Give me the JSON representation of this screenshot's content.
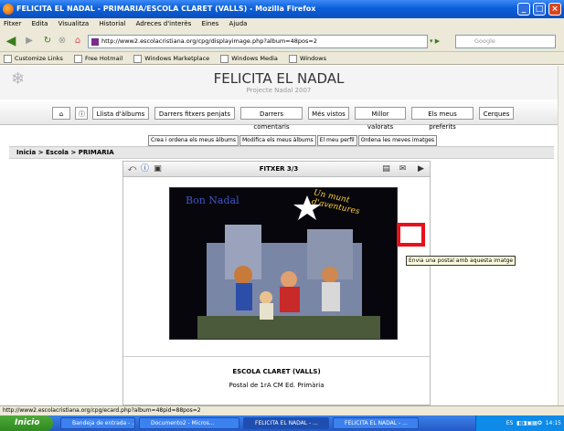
{
  "window": {
    "title": "FELICITA EL NADAL - PRIMARIA/ESCOLA CLARET (VALLS) - Mozilla Firefox"
  },
  "menubar": [
    "Fitxer",
    "Edita",
    "Visualitza",
    "Historial",
    "Adreces d'interès",
    "Eines",
    "Ajuda"
  ],
  "nav": {
    "url": "http://www2.escolacristiana.org/cpg/displayimage.php?album=48pos=2",
    "search_placeholder": "Google"
  },
  "bookmarks": [
    "Customize Links",
    "Free Hotmail",
    "Windows Marketplace",
    "Windows Media",
    "Windows"
  ],
  "site": {
    "title": "FELICITA EL NADAL",
    "subtitle": "Projecte Nadal 2007"
  },
  "tabs": [
    "Llista d'àlbums",
    "Darrers fitxers penjats",
    "Darrers comentaris",
    "Més vistos",
    "Millor valorats",
    "Els meus preferits",
    "Cerques"
  ],
  "subnav": [
    "Crea i ordena els meus àlbums",
    "Modifica els meus àlbums",
    "El meu perfil",
    "Ordena les meves imatges"
  ],
  "breadcrumb": "Inicia > Escola > PRIMARIA",
  "viewer": {
    "title": "FITXER 3/3",
    "tooltip": "Envia una postal amb aquesta imatge",
    "image_text_left": "Bon Nadal",
    "image_text_right": "Un munt d'aventures",
    "caption_title": "ESCOLA CLARET (VALLS)",
    "caption_sub": "Postal de 1rA CM Ed. Primària"
  },
  "statusbar": "http://www2.escolacristiana.org/cpg/ecard.php?album=48pid=88pos=2",
  "taskbar": {
    "start": "Inicio",
    "tasks": [
      "Bandeja de entrada - ...",
      "Documento2 - Micros...",
      "FELICITA EL NADAL - ...",
      "FELICITA EL NADAL - ..."
    ],
    "lang": "ES",
    "clock": "14:15"
  }
}
